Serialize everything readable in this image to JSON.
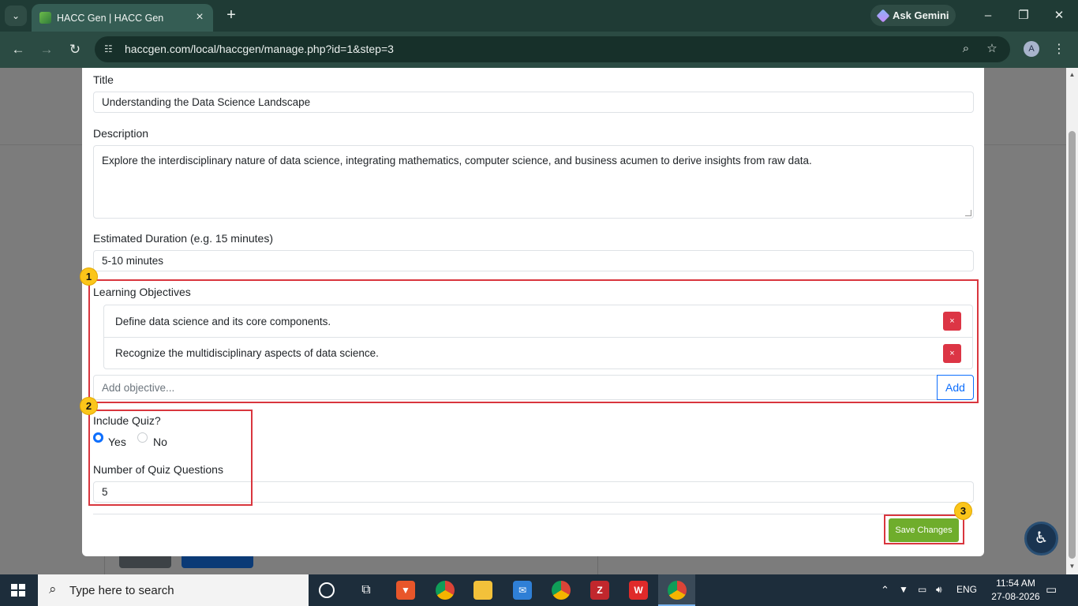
{
  "browser": {
    "tab_title": "HACC Gen | HACC Gen",
    "gemini_label": "Ask Gemini",
    "url": "haccgen.com/local/haccgen/manage.php?id=1&step=3",
    "avatar_letter": "A"
  },
  "form": {
    "title_label": "Title",
    "title_value": "Understanding the Data Science Landscape",
    "description_label": "Description",
    "description_value": "Explore the interdisciplinary nature of data science, integrating mathematics, computer science, and business acumen to derive insights from raw data.",
    "duration_label": "Estimated Duration (e.g. 15 minutes)",
    "duration_value": "5-10 minutes",
    "objectives_label": "Learning Objectives",
    "objectives": [
      {
        "text": "Define data science and its core components.",
        "delete_label": "×"
      },
      {
        "text": "Recognize the multidisciplinary aspects of data science.",
        "delete_label": "×"
      }
    ],
    "objective_placeholder": "Add objective...",
    "add_label": "Add",
    "quiz_label": "Include Quiz?",
    "quiz_yes": "Yes",
    "quiz_no": "No",
    "quiz_selected": "Yes",
    "quiz_count_label": "Number of Quiz Questions",
    "quiz_count_value": "5",
    "save_label": "Save Changes"
  },
  "annotations": [
    "1",
    "2",
    "3"
  ],
  "taskbar": {
    "search_placeholder": "Type here to search",
    "language": "ENG",
    "time": "11:54 AM",
    "date": "27-08-2026"
  },
  "colors": {
    "accent": "#0d6efd",
    "danger": "#dc3545",
    "save": "#6fad2c",
    "annotation_box": "#d9363e",
    "annotation_badge": "#fbc51a"
  }
}
